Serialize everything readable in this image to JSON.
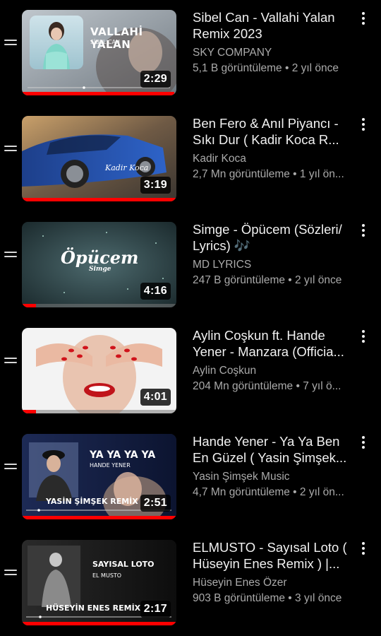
{
  "videos": [
    {
      "title": "Sibel Can - Vallahi Yalan Remix 2023",
      "channel": "SKY COMPANY",
      "meta": "5,1 B görüntüleme • 2 yıl önce",
      "duration": "2:29",
      "progress": 0.985,
      "overlay_lines": [
        "VALLAHİ YALAN",
        "SİBEL CAN"
      ]
    },
    {
      "title": "Ben Fero & Anıl Piyancı - Sıkı Dur ( Kadir Koca R...",
      "channel": "Kadir Koca",
      "meta": "2,7 Mn görüntüleme • 1 yıl ön...",
      "duration": "3:19",
      "progress": 1.0,
      "overlay_lines": [
        "Kadir Koca"
      ]
    },
    {
      "title": "Simge - Öpücem (Sözleri/ Lyrics) 🎶",
      "channel": "MD LYRICS",
      "meta": "247 B görüntüleme • 2 yıl önce",
      "duration": "4:16",
      "progress": 0.09,
      "overlay_lines": [
        "Öpücem",
        "Simge"
      ]
    },
    {
      "title": "Aylin Coşkun ft. Hande Yener - Manzara (Officia...",
      "channel": "Aylin Coşkun",
      "meta": "204 Mn görüntüleme • 7 yıl ö...",
      "duration": "4:01",
      "progress": 0.09,
      "overlay_lines": []
    },
    {
      "title": "Hande Yener - Ya Ya Ben En Güzel ( Yasin Şimşek...",
      "channel": "Yasin Şimşek Music",
      "meta": "4,7 Mn görüntüleme • 2 yıl ön...",
      "duration": "2:51",
      "progress": 1.0,
      "overlay_lines": [
        "YA YA YA YA",
        "HANDE YENER",
        "YASİN ŞİMŞEK REMİX"
      ]
    },
    {
      "title": "ELMUSTO - Sayısal Loto ( Hüseyin Enes Remix ) |...",
      "channel": "Hüseyin Enes Özer",
      "meta": "903 B görüntüleme • 3 yıl önce",
      "duration": "2:17",
      "progress": 1.0,
      "overlay_lines": [
        "SAYISAL LOTO",
        "EL MUSTO",
        "HÜSEYİN ENES REMİX"
      ]
    }
  ],
  "colors": {
    "background": "#000000",
    "progress_red": "#ff0000",
    "secondary_text": "#aaaaaa"
  },
  "icons": {
    "drag_handle": "drag-handle-icon",
    "more": "more-vertical-icon"
  }
}
